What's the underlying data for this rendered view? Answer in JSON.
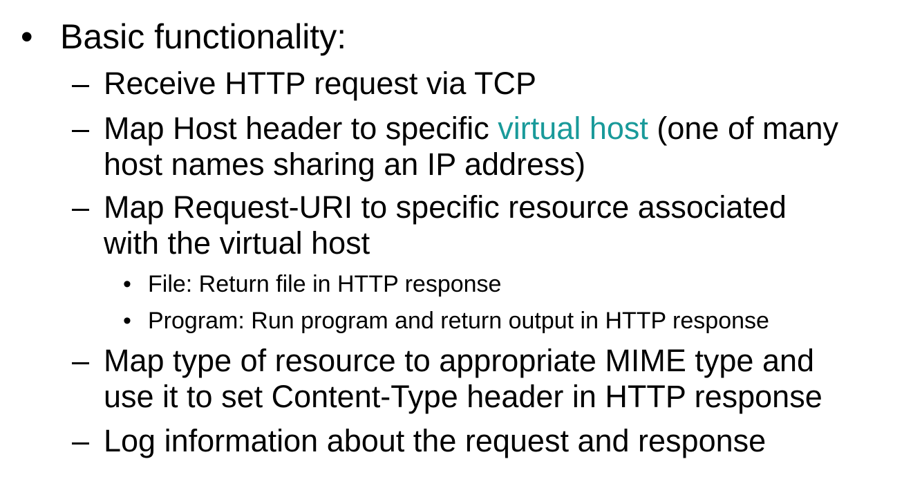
{
  "slide": {
    "bullet_char": "•",
    "dash_char": "–",
    "sub_bullet_char": "•",
    "accent_color": "#199A9A",
    "heading": "Basic functionality:",
    "items": [
      {
        "text": "Receive HTTP request via TCP"
      },
      {
        "text_before": "Map Host header to specific ",
        "link_text": "virtual host",
        "text_after": " (one of many",
        "line2": "host names sharing an IP address)"
      },
      {
        "line1": "Map Request-URI to specific resource associated",
        "line2": "with the virtual host",
        "subitems": [
          {
            "text": "File: Return file in HTTP response"
          },
          {
            "text": "Program: Run program and return output in HTTP response"
          }
        ]
      },
      {
        "line1": "Map type of resource to appropriate MIME type and",
        "line2": "use it to set Content-Type header in HTTP response"
      },
      {
        "text": "Log information about the request and response"
      }
    ]
  }
}
